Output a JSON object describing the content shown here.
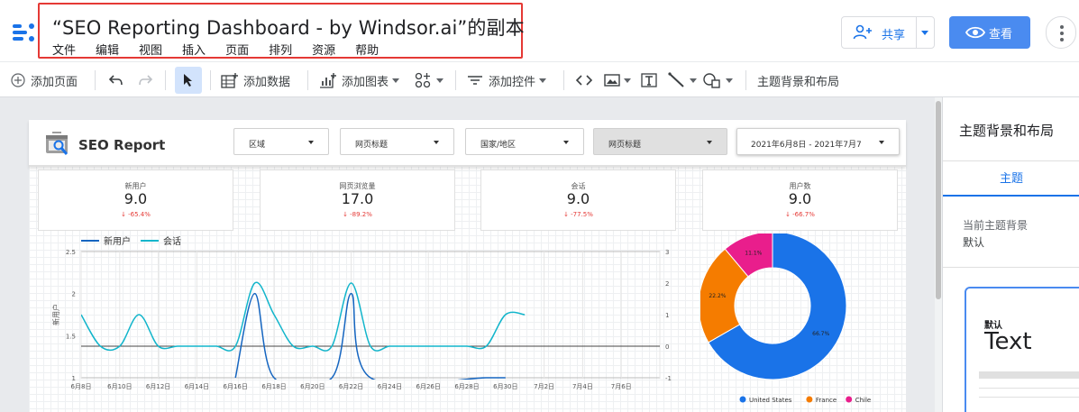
{
  "header": {
    "title": "“SEO Reporting Dashboard - by Windsor.ai”的副本",
    "menu": [
      "文件",
      "编辑",
      "视图",
      "插入",
      "页面",
      "排列",
      "资源",
      "帮助"
    ],
    "share_label": "共享",
    "view_label": "查看"
  },
  "toolbar": {
    "add_page": "添加页面",
    "add_data": "添加数据",
    "add_chart": "添加图表",
    "add_control": "添加控件",
    "theme_layout": "主题背景和布局"
  },
  "report": {
    "title": "SEO Report",
    "filters": [
      "区域",
      "网页标题",
      "国家/地区",
      "网页标题"
    ],
    "date_range": "2021年6月8日 - 2021年7月7日",
    "scorecards": [
      {
        "title": "新用户",
        "value": "9.0",
        "delta": "↓ -65.4%"
      },
      {
        "title": "网页浏览量",
        "value": "17.0",
        "delta": "↓ -89.2%"
      },
      {
        "title": "会话",
        "value": "9.0",
        "delta": "↓ -77.5%"
      },
      {
        "title": "用户数",
        "value": "9.0",
        "delta": "↓ -66.7%"
      }
    ]
  },
  "chart_data": [
    {
      "type": "line",
      "legend": [
        "新用户",
        "会话"
      ],
      "colors": {
        "新用户": "#1565c0",
        "会话": "#12b5cb"
      },
      "ylabel": "新用户",
      "x": [
        "6月8日",
        "6月10日",
        "6月12日",
        "6月14日",
        "6月16日",
        "6月18日",
        "6月20日",
        "6月22日",
        "6月24日",
        "6月26日",
        "6月28日",
        "6月30日",
        "7月2日",
        "7月4日",
        "7月6日"
      ],
      "yleft_ticks": [
        "2.5",
        "2",
        "1.5",
        "1"
      ],
      "yright_ticks": [
        "3",
        "2",
        "1",
        "0",
        "-1"
      ],
      "ylim_left": [
        1,
        2.5
      ],
      "ylim_right": [
        -1,
        3
      ],
      "series": [
        {
          "name": "会话",
          "axis": "right",
          "dates": [
            "6月8日",
            "6月9日",
            "6月10日",
            "6月11日",
            "6月12日",
            "6月13日",
            "6月14日",
            "6月15日",
            "6月16日",
            "6月17日",
            "6月18日",
            "6月19日",
            "6月20日",
            "6月21日",
            "6月22日",
            "6月23日",
            "6月24日",
            "6月25日",
            "6月26日",
            "6月27日",
            "6月28日",
            "6月29日",
            "6月30日",
            "7月1日"
          ],
          "values": [
            1,
            0,
            0,
            1,
            0,
            0,
            0,
            0,
            0,
            2,
            1,
            0,
            0,
            0,
            2,
            0,
            0,
            0,
            0,
            0,
            0,
            0,
            1,
            1
          ]
        },
        {
          "name": "新用户",
          "axis": "left",
          "dates": [
            "6月16日",
            "6月17日",
            "6月18日",
            "6月21日",
            "6月22日",
            "6月23日",
            "6月29日",
            "6月30日"
          ],
          "values": [
            1,
            2,
            1,
            1,
            2,
            1,
            1,
            1
          ]
        }
      ]
    },
    {
      "type": "pie",
      "donut": true,
      "legend_position": "bottom",
      "slices": [
        {
          "label": "United States",
          "value": 66.7,
          "color": "#1a73e8"
        },
        {
          "label": "France",
          "value": 22.2,
          "color": "#f57c00"
        },
        {
          "label": "Chile",
          "value": 11.1,
          "color": "#e91e8c"
        }
      ],
      "slice_labels": [
        "66.7%",
        "22.2%",
        "11.1%"
      ]
    }
  ],
  "panel": {
    "title": "主题背景和布局",
    "tab": "主题",
    "current_theme_label": "当前主题背景",
    "current_theme_value": "默认",
    "theme_card_name": "默认",
    "theme_card_text": "Text"
  }
}
